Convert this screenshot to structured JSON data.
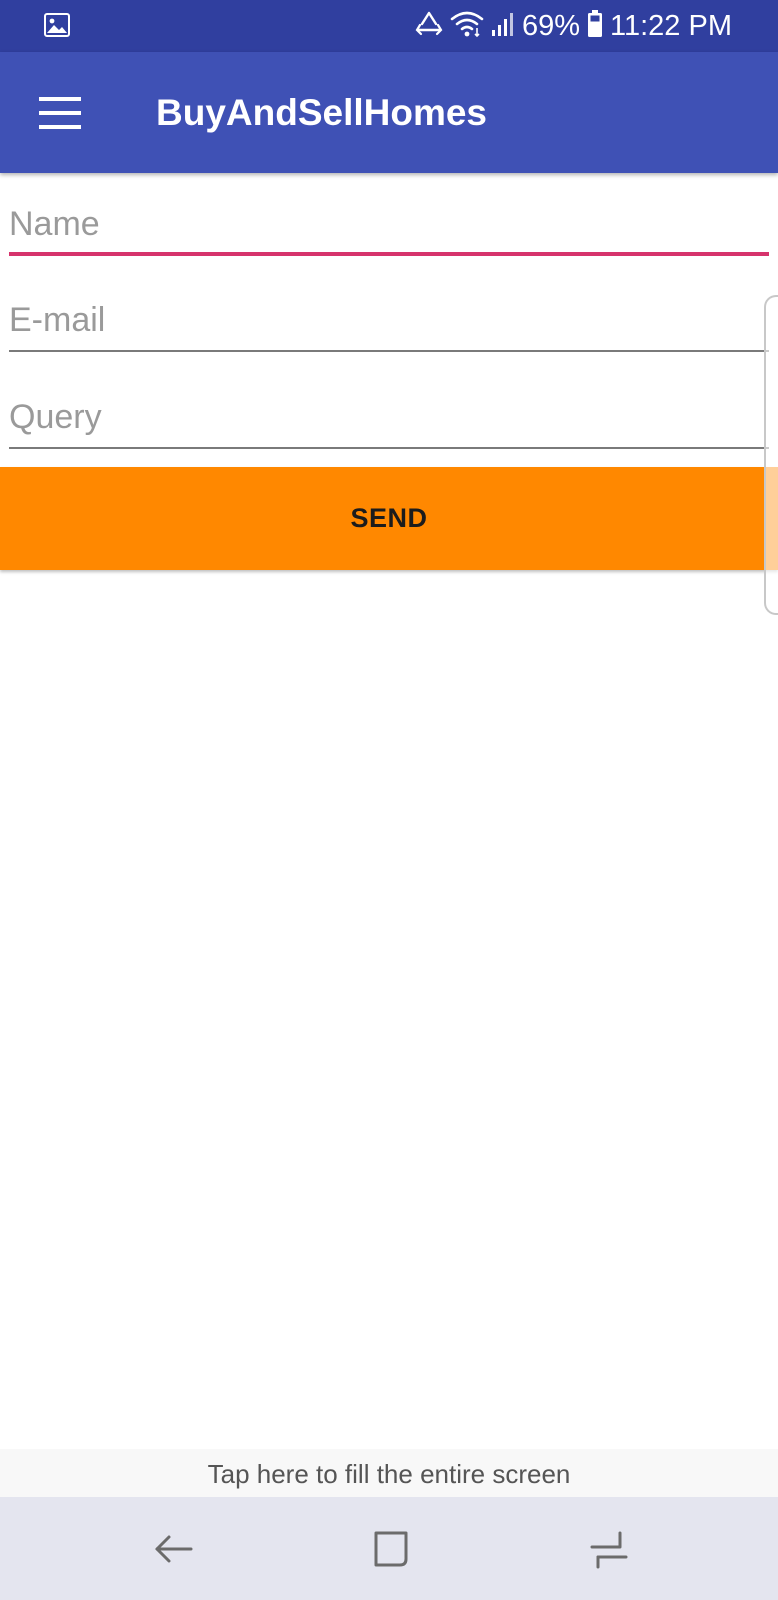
{
  "status_bar": {
    "battery": "69%",
    "time": "11:22 PM",
    "icons": [
      "gallery-icon",
      "recycle-sync-icon",
      "wifi-icon",
      "signal-icon",
      "battery-icon"
    ]
  },
  "app_bar": {
    "title": "BuyAndSellHomes",
    "menu_icon": "hamburger-menu-icon"
  },
  "form": {
    "name": {
      "placeholder": "Name",
      "value": ""
    },
    "email": {
      "placeholder": "E-mail",
      "value": ""
    },
    "query": {
      "placeholder": "Query",
      "value": ""
    },
    "send_label": "SEND"
  },
  "fill_screen_hint": "Tap here to fill the entire screen",
  "nav_bar": {
    "icons": [
      "back-icon",
      "home-icon",
      "recents-icon"
    ]
  },
  "colors": {
    "status_bar": "#303f9f",
    "app_bar": "#3f51b5",
    "accent": "#d6336c",
    "send_button": "#ff8800",
    "nav_bar": "#e4e5ef"
  }
}
